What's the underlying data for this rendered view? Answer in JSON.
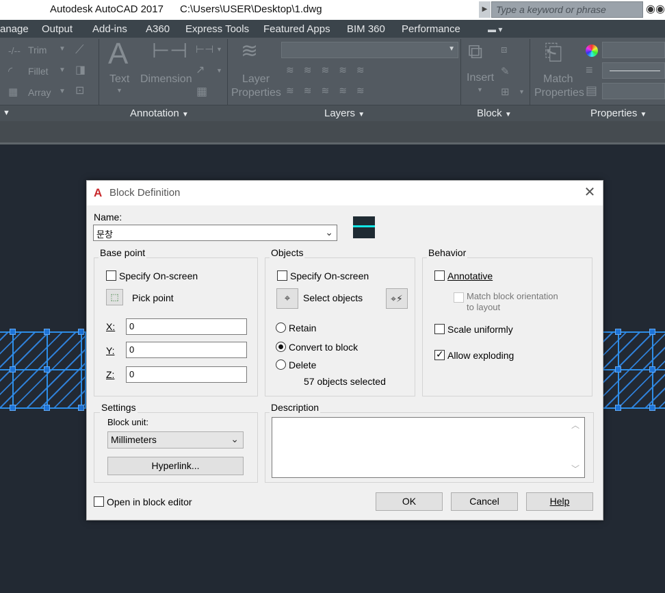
{
  "titlebar": {
    "app_title": "Autodesk AutoCAD 2017",
    "file_path": "C:\\Users\\USER\\Desktop\\1.dwg",
    "search_placeholder": "Type a keyword or phrase"
  },
  "tabs": [
    "anage",
    "Output",
    "Add-ins",
    "A360",
    "Express Tools",
    "Featured Apps",
    "BIM 360",
    "Performance"
  ],
  "ribbon": {
    "modify": {
      "trim": "Trim",
      "fillet": "Fillet",
      "array": "Array"
    },
    "annotation": {
      "text": "Text",
      "dimension": "Dimension",
      "panel": "Annotation"
    },
    "layers": {
      "layer_properties_1": "Layer",
      "layer_properties_2": "Properties",
      "panel": "Layers"
    },
    "block": {
      "insert": "Insert",
      "panel": "Block"
    },
    "properties": {
      "match_1": "Match",
      "match_2": "Properties",
      "panel": "Properties"
    }
  },
  "dialog": {
    "title": "Block Definition",
    "name_label": "Name:",
    "name_value": "문창",
    "base_point": {
      "title": "Base point",
      "specify_onscreen": "Specify On-screen",
      "specify_onscreen_checked": false,
      "pick_point": "Pick point",
      "x_label": "X:",
      "x_value": "0",
      "y_label": "Y:",
      "y_value": "0",
      "z_label": "Z:",
      "z_value": "0"
    },
    "objects": {
      "title": "Objects",
      "specify_onscreen": "Specify On-screen",
      "specify_onscreen_checked": false,
      "select_objects": "Select objects",
      "retain": "Retain",
      "convert_to_block": "Convert to block",
      "delete": "Delete",
      "selected_option": "convert_to_block",
      "selection_count_text": "57 objects selected"
    },
    "behavior": {
      "title": "Behavior",
      "annotative": "Annotative",
      "annotative_checked": false,
      "match_orientation_1": "Match block orientation",
      "match_orientation_2": "to layout",
      "scale_uniformly": "Scale uniformly",
      "scale_uniformly_checked": false,
      "allow_exploding": "Allow exploding",
      "allow_exploding_checked": true
    },
    "settings": {
      "title": "Settings",
      "block_unit_label": "Block unit:",
      "block_unit_value": "Millimeters",
      "hyperlink": "Hyperlink..."
    },
    "description": {
      "title": "Description",
      "value": ""
    },
    "open_in_editor": "Open in block editor",
    "open_in_editor_checked": false,
    "buttons": {
      "ok": "OK",
      "cancel": "Cancel",
      "help": "Help"
    }
  },
  "colors": {
    "accent_red": "#c9292c",
    "selection_blue": "#2d8ee8",
    "canvas": "#222933",
    "ribbon": "#535a61"
  }
}
